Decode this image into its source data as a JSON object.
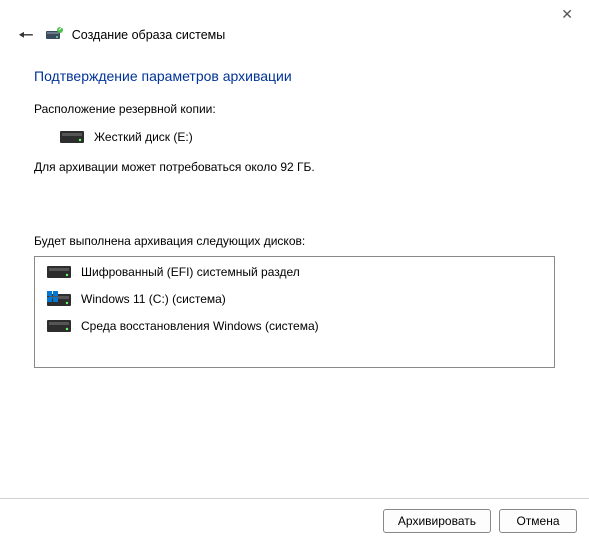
{
  "window": {
    "title": "Создание образа системы"
  },
  "header": {
    "title": "Подтверждение параметров архивации"
  },
  "destination": {
    "label": "Расположение резервной копии:",
    "drive": "Жесткий диск (E:)"
  },
  "size_notice": "Для архивации может потребоваться около 92 ГБ.",
  "drives": {
    "label": "Будет выполнена архивация следующих дисков:",
    "items": [
      "Шифрованный (EFI) системный раздел",
      "Windows 11 (C:) (система)",
      "Среда восстановления Windows (система)"
    ]
  },
  "buttons": {
    "archive": "Архивировать",
    "cancel": "Отмена"
  }
}
